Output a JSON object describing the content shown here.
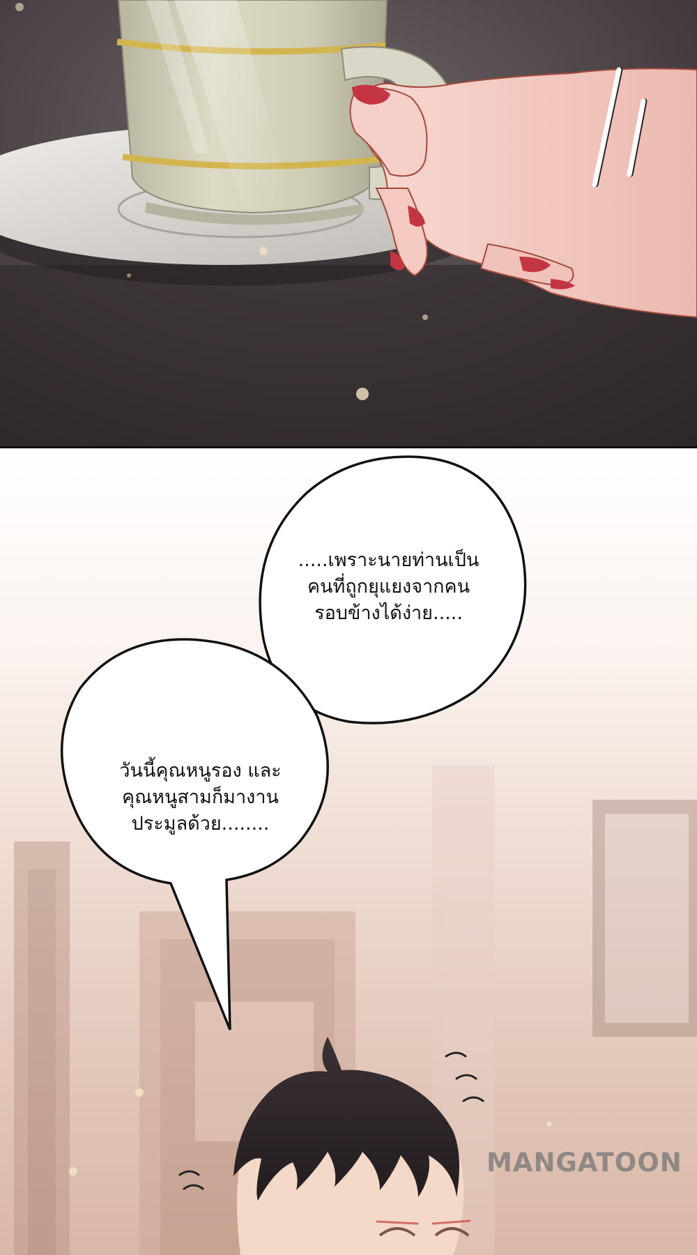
{
  "bubbles": [
    {
      "lines": [
        ".....เพราะนายท่านเป็น",
        "คนที่ถูกยุแยงจากคน",
        "รอบข้างได้ง่าย....."
      ]
    },
    {
      "lines": [
        "วันนี้คุณหนูรอง และ",
        "คุณหนูสามก็มางาน",
        "ประมูลด้วย........"
      ]
    }
  ],
  "watermark": {
    "text": "MANGATOON"
  },
  "colors": {
    "table_dark": "#2f2a2d",
    "saucer": "#dedbd6",
    "cup": "#cfcdb4",
    "cup_band": "#d3b54f",
    "skin": "#f3c9c1",
    "nail": "#c43543",
    "hair": "#2b2426",
    "bubble_fill": "#ffffff",
    "bubble_stroke": "#111111",
    "background_warm": "#e8d2c8"
  },
  "icons": {
    "speed_lines": "speed-lines-icon",
    "sweat_drops": "sweat-drop-icon"
  }
}
